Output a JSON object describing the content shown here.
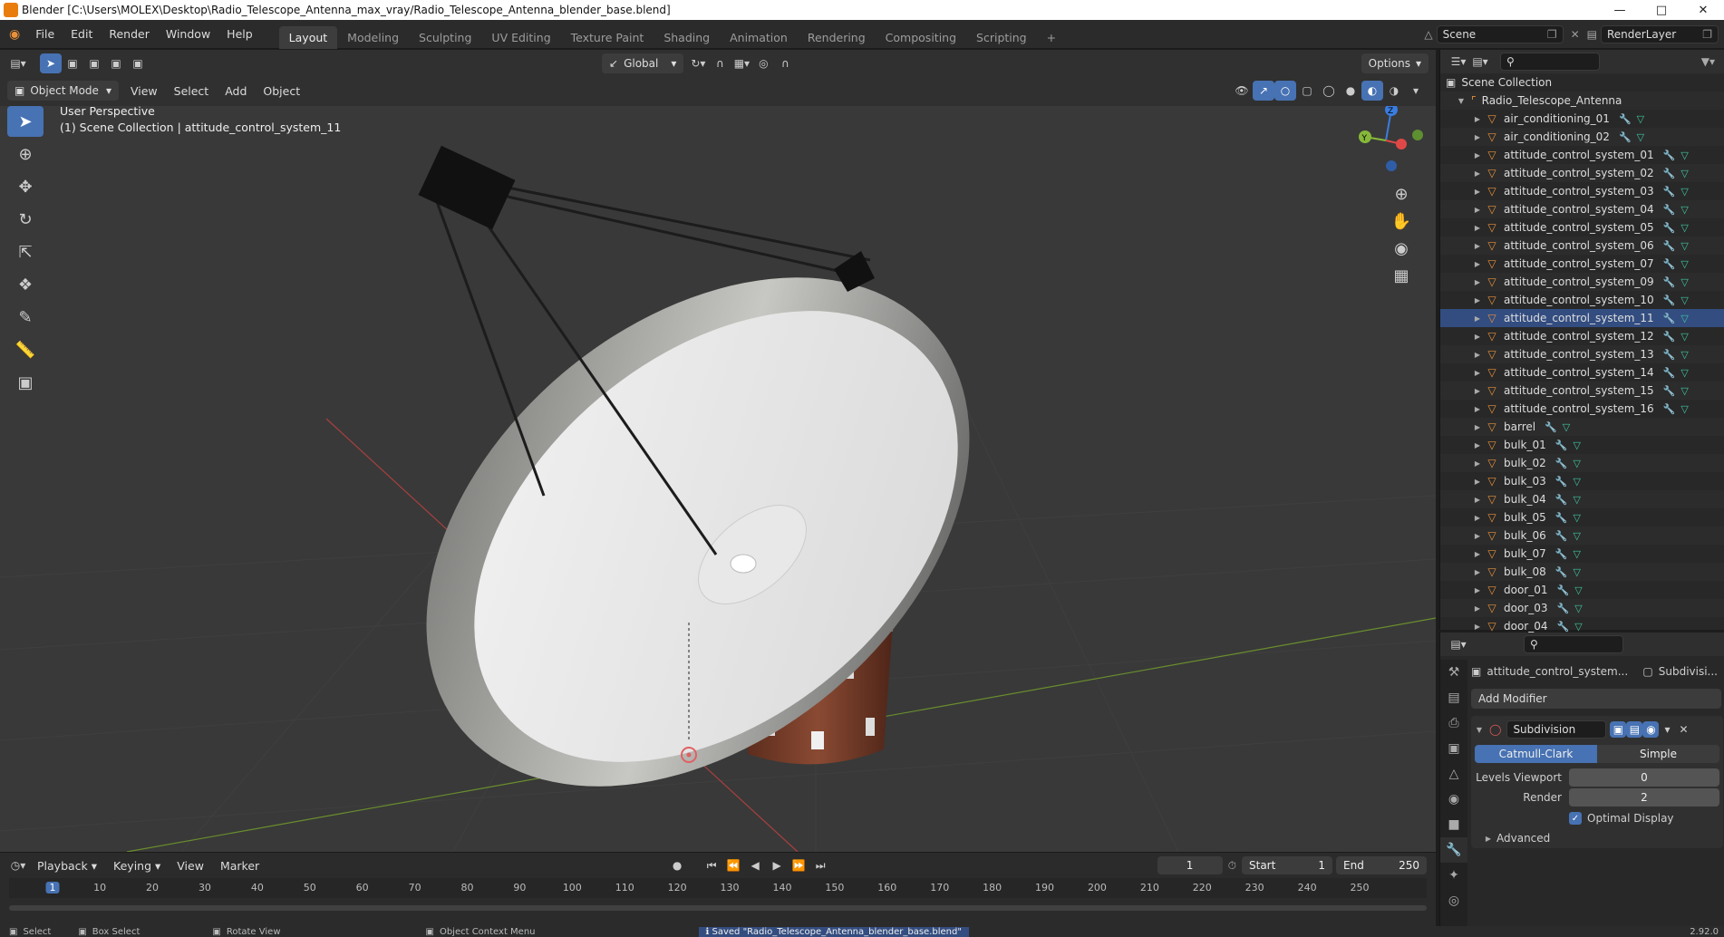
{
  "window": {
    "title": "Blender [C:\\Users\\MOLEX\\Desktop\\Radio_Telescope_Antenna_max_vray/Radio_Telescope_Antenna_blender_base.blend]"
  },
  "menu": [
    "File",
    "Edit",
    "Render",
    "Window",
    "Help"
  ],
  "workspaces": [
    "Layout",
    "Modeling",
    "Sculpting",
    "UV Editing",
    "Texture Paint",
    "Shading",
    "Animation",
    "Rendering",
    "Compositing",
    "Scripting"
  ],
  "scene": {
    "name": "Scene",
    "render_layer": "RenderLayer"
  },
  "viewport_header": {
    "mode": "Object Mode",
    "menus": [
      "View",
      "Select",
      "Add",
      "Object"
    ],
    "transform": "Global",
    "options": "Options"
  },
  "viewport": {
    "info_line1": "User Perspective",
    "info_line2": "(1) Scene Collection | attitude_control_system_11",
    "gizmo": {
      "z": "Z",
      "y": "Y"
    }
  },
  "outliner": {
    "root": "Scene Collection",
    "collection": "Radio_Telescope_Antenna",
    "items": [
      "air_conditioning_01",
      "air_conditioning_02",
      "attitude_control_system_01",
      "attitude_control_system_02",
      "attitude_control_system_03",
      "attitude_control_system_04",
      "attitude_control_system_05",
      "attitude_control_system_06",
      "attitude_control_system_07",
      "attitude_control_system_09",
      "attitude_control_system_10",
      "attitude_control_system_11",
      "attitude_control_system_12",
      "attitude_control_system_13",
      "attitude_control_system_14",
      "attitude_control_system_15",
      "attitude_control_system_16",
      "barrel",
      "bulk_01",
      "bulk_02",
      "bulk_03",
      "bulk_04",
      "bulk_05",
      "bulk_06",
      "bulk_07",
      "bulk_08",
      "door_01",
      "door_03",
      "door_04"
    ],
    "selected": "attitude_control_system_11"
  },
  "properties": {
    "object_name": "attitude_control_system...",
    "modifier_tab": "Subdivisi...",
    "add_modifier": "Add Modifier",
    "modifier_name": "Subdivision",
    "type_options": [
      "Catmull-Clark",
      "Simple"
    ],
    "levels_viewport_label": "Levels Viewport",
    "levels_viewport": "0",
    "render_label": "Render",
    "render": "2",
    "optimal_display": "Optimal Display",
    "advanced": "Advanced"
  },
  "timeline": {
    "menus": [
      "Playback",
      "Keying",
      "View",
      "Marker"
    ],
    "current_frame": "1",
    "start_label": "Start",
    "start": "1",
    "end_label": "End",
    "end": "250",
    "ruler": [
      "1",
      "10",
      "20",
      "30",
      "40",
      "50",
      "60",
      "70",
      "80",
      "90",
      "100",
      "110",
      "120",
      "130",
      "140",
      "150",
      "160",
      "170",
      "180",
      "190",
      "200",
      "210",
      "220",
      "230",
      "240",
      "250"
    ]
  },
  "status": {
    "select": "Select",
    "box_select": "Box Select",
    "rotate": "Rotate View",
    "context": "Object Context Menu",
    "message": "Saved \"Radio_Telescope_Antenna_blender_base.blend\"",
    "version": "2.92.0"
  },
  "colors": {
    "accent": "#4772b3",
    "mesh": "#e8913b",
    "selected_row": "#334d80"
  }
}
